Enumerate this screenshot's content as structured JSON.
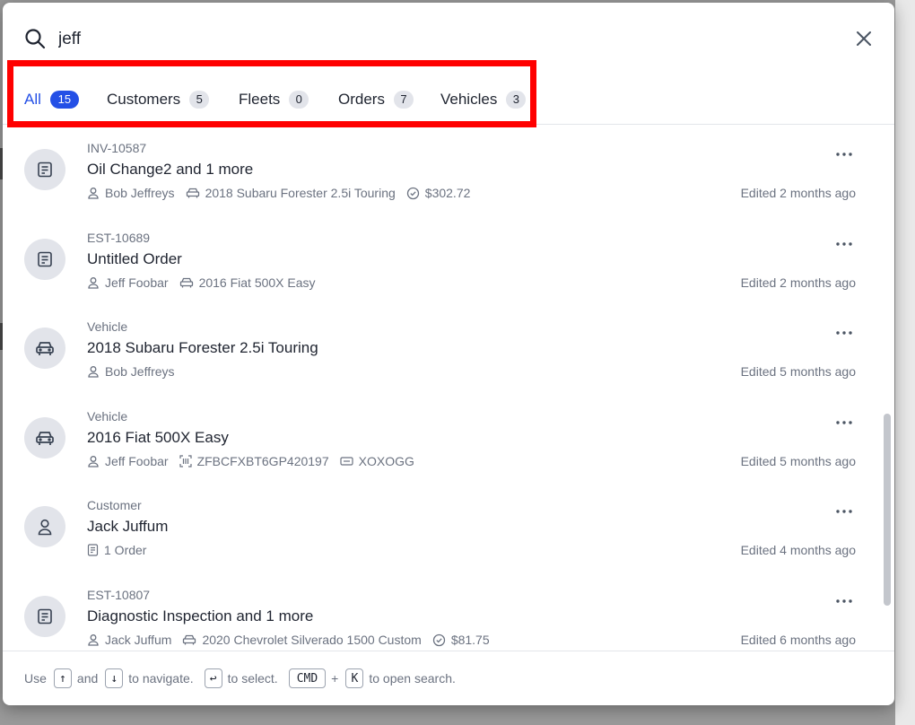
{
  "search": {
    "query": "jeff",
    "placeholder": ""
  },
  "tabs": [
    {
      "label": "All",
      "count": "15",
      "active": true
    },
    {
      "label": "Customers",
      "count": "5",
      "active": false
    },
    {
      "label": "Fleets",
      "count": "0",
      "active": false
    },
    {
      "label": "Orders",
      "count": "7",
      "active": false
    },
    {
      "label": "Vehicles",
      "count": "3",
      "active": false
    }
  ],
  "results": [
    {
      "icon": "invoice-icon",
      "type": "INV-10587",
      "title": "Oil Change2 and 1 more",
      "meta": {
        "customer": "Bob Jeffreys",
        "vehicle": "2018 Subaru Forester 2.5i Touring",
        "amount": "$302.72"
      },
      "edited": "Edited 2 months ago"
    },
    {
      "icon": "invoice-icon",
      "type": "EST-10689",
      "title": "Untitled Order",
      "meta": {
        "customer": "Jeff Foobar",
        "vehicle": "2016 Fiat 500X Easy"
      },
      "edited": "Edited 2 months ago"
    },
    {
      "icon": "car-icon",
      "type": "Vehicle",
      "title": "2018 Subaru Forester 2.5i Touring",
      "meta": {
        "customer": "Bob Jeffreys"
      },
      "edited": "Edited 5 months ago"
    },
    {
      "icon": "car-icon",
      "type": "Vehicle",
      "title": "2016 Fiat 500X Easy",
      "meta": {
        "customer": "Jeff Foobar",
        "vin": "ZFBCFXBT6GP420197",
        "plate": "XOXOGG"
      },
      "edited": "Edited 5 months ago"
    },
    {
      "icon": "person-icon",
      "type": "Customer",
      "title": "Jack Juffum",
      "meta": {
        "orders": "1 Order"
      },
      "edited": "Edited 4 months ago"
    },
    {
      "icon": "invoice-icon",
      "type": "EST-10807",
      "title": "Diagnostic Inspection and 1 more",
      "meta": {
        "customer": "Jack Juffum",
        "vehicle": "2020 Chevrolet Silverado 1500 Custom",
        "amount": "$81.75"
      },
      "edited": "Edited 6 months ago"
    }
  ],
  "footer": {
    "use": "Use",
    "up_key": "↑",
    "and": "and",
    "down_key": "↓",
    "navigate": "to navigate.",
    "enter_key": "↩",
    "select": "to select.",
    "cmd_key": "CMD",
    "plus": "+",
    "k_key": "K",
    "open_search": "to open search."
  },
  "colors": {
    "accent": "#2450e6",
    "highlight": "#ff0000"
  }
}
